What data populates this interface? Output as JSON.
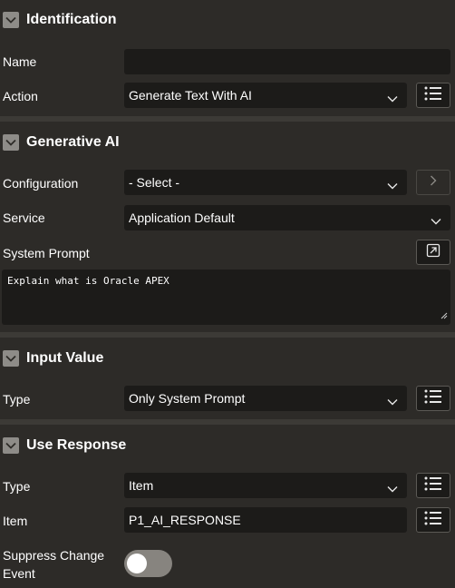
{
  "identification": {
    "title": "Identification",
    "name_label": "Name",
    "name_value": "",
    "action_label": "Action",
    "action_value": "Generate Text With AI"
  },
  "generative_ai": {
    "title": "Generative AI",
    "configuration_label": "Configuration",
    "configuration_value": "- Select -",
    "service_label": "Service",
    "service_value": "Application Default",
    "system_prompt_label": "System Prompt",
    "system_prompt_value": "Explain what is Oracle APEX"
  },
  "input_value": {
    "title": "Input Value",
    "type_label": "Type",
    "type_value": "Only System Prompt"
  },
  "use_response": {
    "title": "Use Response",
    "type_label": "Type",
    "type_value": "Item",
    "item_label": "Item",
    "item_value": "P1_AI_RESPONSE",
    "suppress_label_line1": "Suppress Change",
    "suppress_label_line2": "Event",
    "suppress_on": false
  },
  "colors": {
    "background": "#2d2b28",
    "field": "#1c1b19",
    "divider": "#3c3a36",
    "caret_box": "#8e8c88",
    "toggle_off": "#87847f"
  },
  "icons": {
    "section_toggle": "chevron-down-icon",
    "select_arrow": "chevron-down-icon",
    "list_picker": "list-icon",
    "next": "chevron-right-icon",
    "expand": "expand-icon",
    "resize": "resize-handle-icon"
  }
}
